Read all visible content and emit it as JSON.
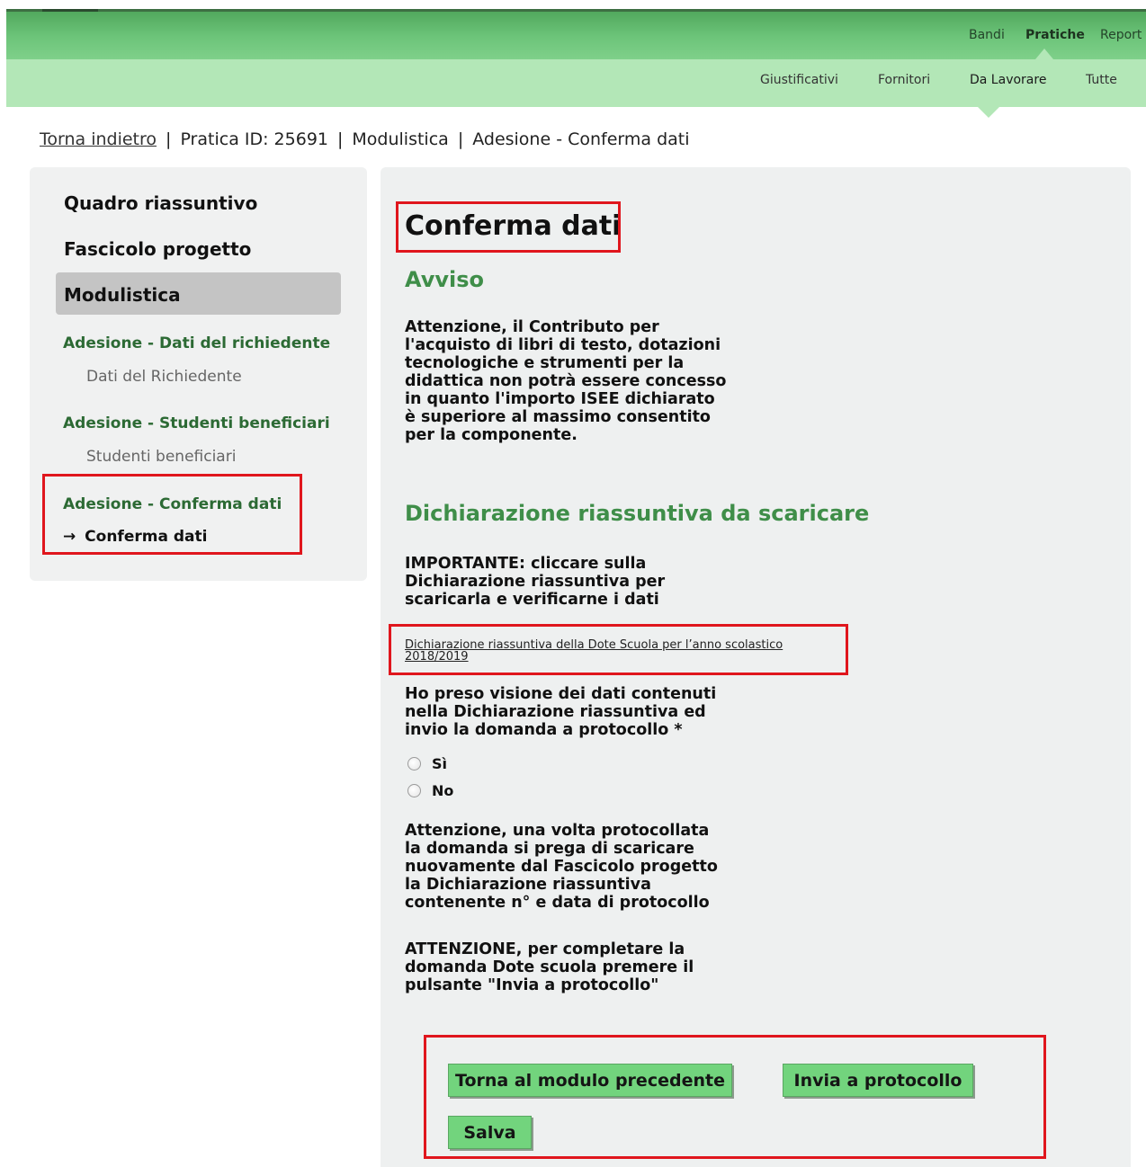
{
  "top_nav": {
    "items": [
      {
        "label": "Bandi",
        "active": false
      },
      {
        "label": "Pratiche",
        "active": true
      },
      {
        "label": "Report",
        "active": false
      }
    ]
  },
  "sub_nav": {
    "items": [
      {
        "label": "Giustificativi",
        "active": false
      },
      {
        "label": "Fornitori",
        "active": false
      },
      {
        "label": "Da Lavorare",
        "active": true
      },
      {
        "label": "Tutte",
        "active": false
      }
    ]
  },
  "breadcrumb": {
    "back_label": "Torna indietro",
    "items": [
      "Pratica ID: 25691",
      "Modulistica",
      "Adesione - Conferma dati"
    ],
    "separator": "|"
  },
  "sidebar": {
    "main_items": [
      "Quadro riassuntivo",
      "Fascicolo progetto",
      "Modulistica"
    ],
    "active_main": "Modulistica",
    "groups": [
      {
        "title": "Adesione - Dati del richiedente",
        "sub": "Dati del Richiedente"
      },
      {
        "title": "Adesione - Studenti beneficiari",
        "sub": "Studenti beneficiari"
      },
      {
        "title": "Adesione - Conferma dati",
        "sub": "Conferma dati",
        "current_marker": "→"
      }
    ]
  },
  "main": {
    "title": "Conferma dati",
    "avviso_heading": "Avviso",
    "avviso_lines": [
      "Attenzione, il Contributo per",
      "l'acquisto di libri di testo, dotazioni",
      "tecnologiche e strumenti per la",
      "didattica non potrà essere concesso",
      "in quanto l'importo ISEE dichiarato",
      "è superiore al massimo consentito",
      "per la componente."
    ],
    "dichiarazione_heading": "Dichiarazione riassuntiva da scaricare",
    "importante_lines": [
      "IMPORTANTE: cliccare sulla",
      "Dichiarazione riassuntiva per",
      "scaricarla e verificarne i dati"
    ],
    "doc_link": "Dichiarazione riassuntiva della Dote Scuola per l’anno scolastico 2018/2019",
    "question_lines": [
      "Ho preso visione dei dati contenuti",
      "nella Dichiarazione riassuntiva ed",
      "invio la domanda a protocollo *"
    ],
    "radio_options": [
      "Sì",
      "No"
    ],
    "warning_lines": [
      "Attenzione, una volta protocollata",
      "la domanda si prega di scaricare",
      "nuovamente dal Fascicolo progetto",
      "la Dichiarazione riassuntiva",
      "contenente n° e data di protocollo"
    ],
    "final_lines": [
      "ATTENZIONE, per completare la",
      "domanda Dote scuola premere il",
      "pulsante \"Invia a protocollo\""
    ],
    "buttons": {
      "back": "Torna al modulo precedente",
      "send": "Invia a protocollo",
      "save": "Salva"
    }
  },
  "colors": {
    "topbar_green": "#6cc479",
    "subbar_green": "#b3e7b7",
    "heading_green": "#3f8e49",
    "button_green": "#72d47d",
    "highlight_red": "#e0161d"
  }
}
